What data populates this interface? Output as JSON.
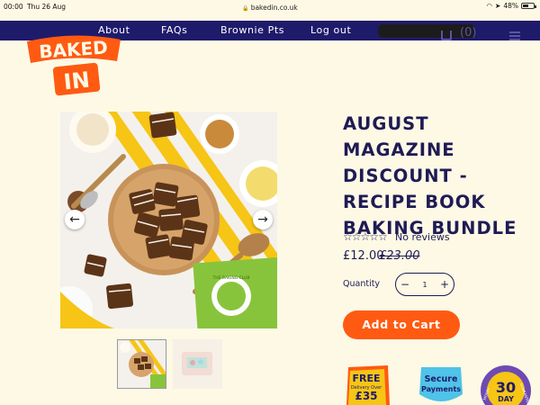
{
  "status_bar": {
    "time": "00:00",
    "date": "Thu 26 Aug",
    "url": "bakedin.co.uk",
    "battery": "48%",
    "battery_level": 0.48
  },
  "nav": {
    "items": [
      "About",
      "FAQs",
      "Brownie Pts",
      "Log out"
    ],
    "cart_count": "(0)"
  },
  "logo": {
    "text": "BAKED IN",
    "color": "#ff5a12"
  },
  "gallery": {
    "prev_arrow": "←",
    "next_arrow": "→",
    "image_badge": "THE BAKING CLUB"
  },
  "product": {
    "title": "AUGUST MAGAZINE DISCOUNT - RECIPE BOOK BAKING BUNDLE",
    "stars": "☆☆☆☆☆",
    "reviews": "No reviews",
    "price": "£12.00",
    "compare_price": "£23.00",
    "quantity_label": "Quantity",
    "quantity_minus": "−",
    "quantity_value": "1",
    "quantity_plus": "+",
    "add_to_cart": "Add to Cart"
  },
  "badges": {
    "free_delivery": {
      "line1": "FREE",
      "line2": "Delivery Over",
      "line3": "£35"
    },
    "secure": {
      "line1": "Secure",
      "line2": "Payments"
    },
    "guarantee": {
      "line1": "30",
      "line2": "DAY",
      "side": "MONEY",
      "side2": "GUARANTEE"
    }
  },
  "colors": {
    "navy": "#1f1b6b",
    "accent_orange": "#ff5a12",
    "background": "#fdf9e5"
  }
}
